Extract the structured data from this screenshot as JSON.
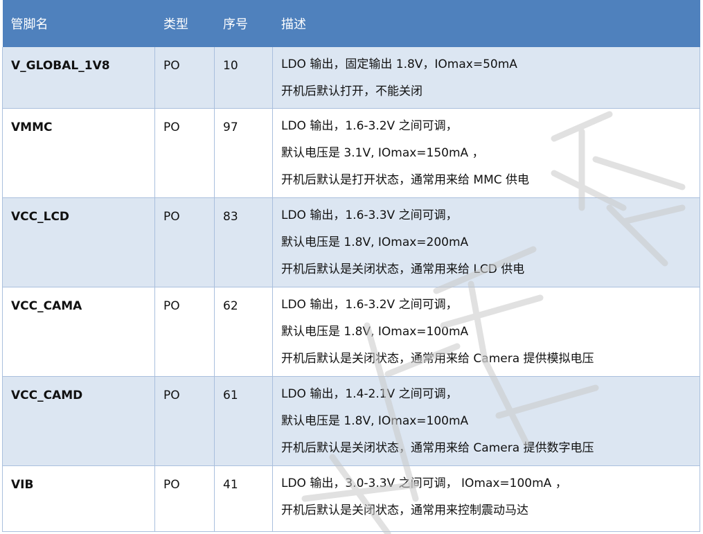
{
  "headers": [
    "管脚名",
    "类型",
    "序号",
    "描述"
  ],
  "rows": [
    {
      "name": "V_GLOBAL_1V8",
      "type": "PO",
      "num": "10",
      "desc": [
        "LDO 输出，固定输出 1.8V，IOmax=50mA",
        "开机后默认打开，不能关闭"
      ]
    },
    {
      "name": "VMMC",
      "type": "PO",
      "num": "97",
      "desc": [
        "LDO 输出，1.6-3.2V 之间可调，",
        "默认电压是 3.1V, IOmax=150mA ，",
        "开机后默认是打开状态，通常用来给 MMC 供电"
      ]
    },
    {
      "name": "VCC_LCD",
      "type": "PO",
      "num": "83",
      "desc": [
        "LDO 输出，1.6-3.3V 之间可调，",
        "默认电压是 1.8V, IOmax=200mA",
        "开机后默认是关闭状态，通常用来给 LCD 供电"
      ]
    },
    {
      "name": "VCC_CAMA",
      "type": "PO",
      "num": "62",
      "desc": [
        "LDO 输出，1.6-3.2V 之间可调，",
        "默认电压是 1.8V, IOmax=100mA",
        "开机后默认是关闭状态，通常用来给 Camera  提供模拟电压"
      ]
    },
    {
      "name": "VCC_CAMD",
      "type": "PO",
      "num": "61",
      "desc": [
        "LDO 输出，1.4-2.1V 之间可调，",
        "默认电压是 1.8V, IOmax=100mA",
        "开机后默认是关闭状态，通常用来给 Camera  提供数字电压"
      ]
    },
    {
      "name": "VIB",
      "type": "PO",
      "num": "41",
      "desc": [
        "LDO 输出，3.0-3.3V 之间可调，   IOmax=100mA ，",
        "开机后默认是关闭状态，通常用来控制震动马达"
      ]
    }
  ]
}
